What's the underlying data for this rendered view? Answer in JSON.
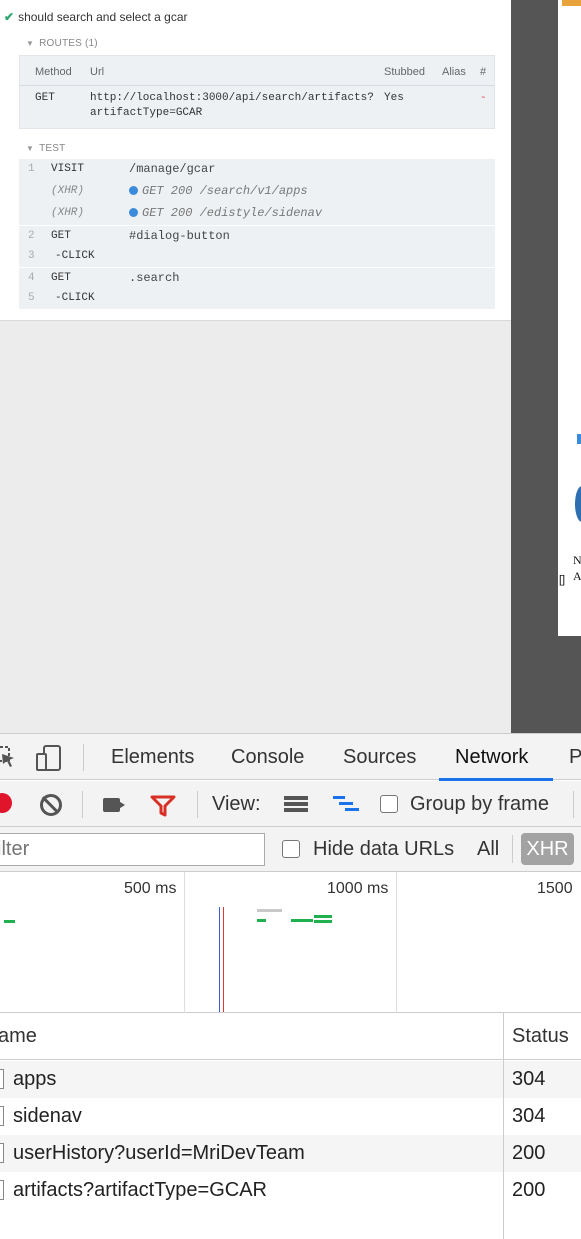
{
  "command_log": {
    "test_title": "should search and select a gcar",
    "routes_header": "ROUTES (1)",
    "routes_columns": {
      "method": "Method",
      "url": "Url",
      "stubbed": "Stubbed",
      "alias": "Alias",
      "count": "#"
    },
    "route": {
      "method": "GET",
      "url_line1": "http://localhost:3000/api/search/artifacts?",
      "url_line2": "artifactType=GCAR",
      "stubbed": "Yes",
      "alias": "-"
    },
    "test_header": "TEST",
    "commands": [
      {
        "num": "1",
        "name": "VISIT",
        "message": "/manage/gcar"
      },
      {
        "num": "",
        "name": "(XHR)",
        "message": "GET 200 /search/v1/apps"
      },
      {
        "num": "",
        "name": "(XHR)",
        "message": "GET 200 /edistyle/sidenav"
      },
      {
        "num": "2",
        "name": "GET",
        "message": "#dialog-button"
      },
      {
        "num": "3",
        "name": "-CLICK",
        "message": ""
      },
      {
        "num": "4",
        "name": "GET",
        "message": ".search"
      },
      {
        "num": "5",
        "name": "-CLICK",
        "message": ""
      }
    ]
  },
  "aut": {
    "text1": "N",
    "text2": "A",
    "bracket": "[]"
  },
  "devtools": {
    "tabs": [
      "Elements",
      "Console",
      "Sources",
      "Network",
      "P"
    ],
    "active_tab": "Network",
    "toolbar": {
      "view_label": "View:",
      "group_by_frame_label": "Group by frame"
    },
    "filter": {
      "placeholder": "ilter",
      "hide_data_urls_label": "Hide data URLs",
      "all_label": "All",
      "xhr_label": "XHR"
    },
    "overview": {
      "ticks": [
        "500 ms",
        "1000 ms",
        "1500"
      ]
    },
    "table": {
      "columns": {
        "name": "ame",
        "status": "Status"
      },
      "rows": [
        {
          "name": "apps",
          "status": "304"
        },
        {
          "name": "sidenav",
          "status": "304"
        },
        {
          "name": "userHistory?userId=MriDevTeam",
          "status": "200"
        },
        {
          "name": "artifacts?artifactType=GCAR",
          "status": "200"
        }
      ]
    },
    "colors": {
      "accent": "#1a73e8",
      "record": "#e0152b",
      "filter": "#d93025",
      "bar_green": "#20b14f",
      "bar_gray": "#c8c8c8",
      "dom_line": "#3b5bdb",
      "load_line": "#e53935"
    }
  }
}
